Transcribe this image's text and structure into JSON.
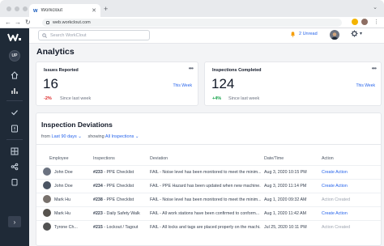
{
  "browser": {
    "tab_title": "Workclout",
    "url": "web.workclout.com"
  },
  "app": {
    "logo_text": "W",
    "sidebar_avatar": "UP",
    "search_placeholder": "Search WorkClout",
    "unread_label": "2 Unread",
    "page_title": "Analytics"
  },
  "cards": [
    {
      "label": "Issues Reported",
      "value": "16",
      "period": "This Week",
      "delta": "-2%",
      "delta_color": "#dc2626",
      "since": "Since last week"
    },
    {
      "label": "Inspections Completed",
      "value": "124",
      "period": "This Week",
      "delta": "+4%",
      "delta_color": "#16a34a",
      "since": "Since last week"
    }
  ],
  "deviations": {
    "title": "Inspection Deviations",
    "from_label": "from",
    "from_value": "Last 90 days",
    "showing_label": "showing",
    "showing_value": "All Inspections",
    "columns": [
      "Employee",
      "Inspections",
      "Deviation",
      "Date/Time",
      "Action"
    ],
    "rows": [
      {
        "employee": "John Doe",
        "inspection": "#233",
        "inspection_name": "- PPE Checklist",
        "deviation": "FAIL - Noise level has been monitored to meet the minim...",
        "datetime": "Aug 3, 2020 10:15 PM",
        "action": "Create Action",
        "action_state": "link"
      },
      {
        "employee": "John Doe",
        "inspection": "#234",
        "inspection_name": "- PPE Checklist",
        "deviation": "FAIL - PPE Hazard has been updated when new machine...",
        "datetime": "Aug 3, 2020 11:14 PM",
        "action": "Create Action",
        "action_state": "link"
      },
      {
        "employee": "Mark Hu",
        "inspection": "#238",
        "inspection_name": "- PPE Checklist",
        "deviation": "FAIL - Noise level has been monitored to meet the minim...",
        "datetime": "Aug 1, 2020 09:32 AM",
        "action": "Action Created",
        "action_state": "done"
      },
      {
        "employee": "Mark Hu",
        "inspection": "#223",
        "inspection_name": "- Daily Safety Walk",
        "deviation": "FAIL - All work stations have been confirmed to conform...",
        "datetime": "Aug 1, 2020 11:42 AM",
        "action": "Create Action",
        "action_state": "link"
      },
      {
        "employee": "Tyrone Ch...",
        "inspection": "#215",
        "inspection_name": "- Lockout / Tagout",
        "deviation": "FAIL - All locks and tags are placed properly on the machi...",
        "datetime": "Jul 25, 2020 10:11 PM",
        "action": "Action Created",
        "action_state": "done"
      }
    ]
  },
  "colors": {
    "sidebar": "#1f2a37",
    "accent": "#2563eb",
    "negative": "#dc2626",
    "positive": "#16a34a"
  }
}
